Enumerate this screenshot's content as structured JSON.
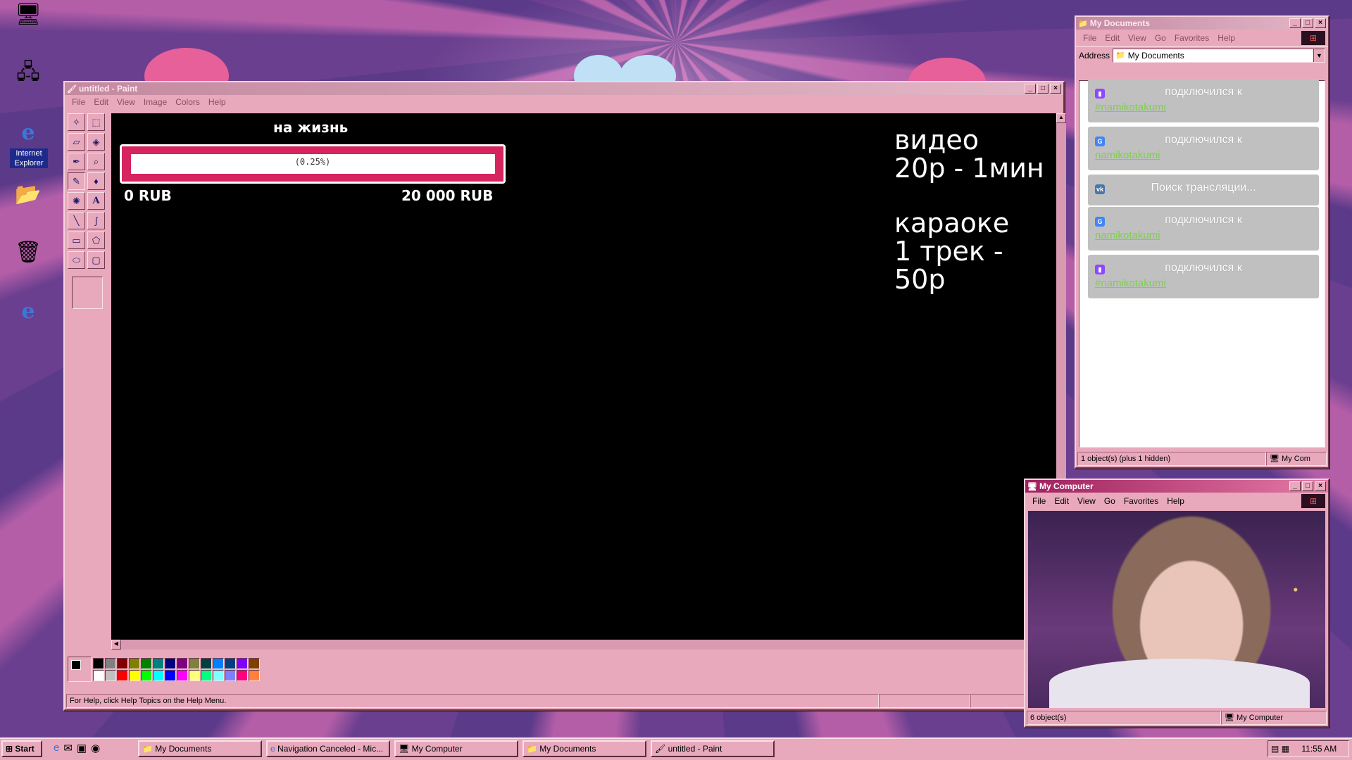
{
  "desktop": {
    "ie_label": "Internet Explorer"
  },
  "paint": {
    "title": "untitled - Paint",
    "menu": [
      "File",
      "Edit",
      "View",
      "Image",
      "Colors",
      "Help"
    ],
    "status": "For Help, click Help Topics on the Help Menu.",
    "overlay": {
      "goal_title": "на жизнь",
      "progress_text": "(0.25%)",
      "progress": 0.0025,
      "min_label": "0 RUB",
      "max_label": "20 000 RUB",
      "price_title1": "видео",
      "price_line1": "20р - 1мин",
      "price_title2": "караоке",
      "price_line2": "1 трек - 50р"
    }
  },
  "mydocs": {
    "title": "My Documents",
    "menu": [
      "File",
      "Edit",
      "View",
      "Go",
      "Favorites",
      "Help"
    ],
    "address_label": "Address",
    "address_value": "My Documents",
    "chat": [
      {
        "platform": "twitch-icon",
        "color": "#9146ff",
        "glyph": "▮",
        "msg": "подключился к",
        "channel": "#namikotakumi"
      },
      {
        "platform": "google-icon",
        "color": "#4285f4",
        "glyph": "G",
        "msg": "подключился к",
        "channel": "namikotakumi"
      },
      {
        "platform": "vk-icon",
        "color": "#4a76a8",
        "glyph": "vk",
        "msg": "Поиск трансляции...",
        "channel": ""
      },
      {
        "platform": "google-icon",
        "color": "#4285f4",
        "glyph": "G",
        "msg": "подключился к",
        "channel": "namikotakumi"
      },
      {
        "platform": "twitch-icon",
        "color": "#9146ff",
        "glyph": "▮",
        "msg": "подключился к",
        "channel": "#namikotakumi"
      }
    ],
    "status_left": "1 object(s) (plus 1 hidden)",
    "status_right": "My Com"
  },
  "mycomputer": {
    "title": "My Computer",
    "menu": [
      "File",
      "Edit",
      "View",
      "Go",
      "Favorites",
      "Help"
    ],
    "status_left": "6 object(s)",
    "status_right": "My Computer"
  },
  "taskbar": {
    "start": "Start",
    "buttons": [
      "My Documents",
      "Navigation Canceled - Mic...",
      "My Computer",
      "My Documents",
      "untitled - Paint"
    ],
    "clock": "11:55 AM"
  },
  "palette": [
    "#000000",
    "#808080",
    "#800000",
    "#808000",
    "#008000",
    "#008080",
    "#000080",
    "#800080",
    "#808040",
    "#004040",
    "#0080ff",
    "#004080",
    "#8000ff",
    "#804000",
    "#ffffff",
    "#c0c0c0",
    "#ff0000",
    "#ffff00",
    "#00ff00",
    "#00ffff",
    "#0000ff",
    "#ff00ff",
    "#ffff80",
    "#00ff80",
    "#80ffff",
    "#8080ff",
    "#ff0080",
    "#ff8040"
  ]
}
